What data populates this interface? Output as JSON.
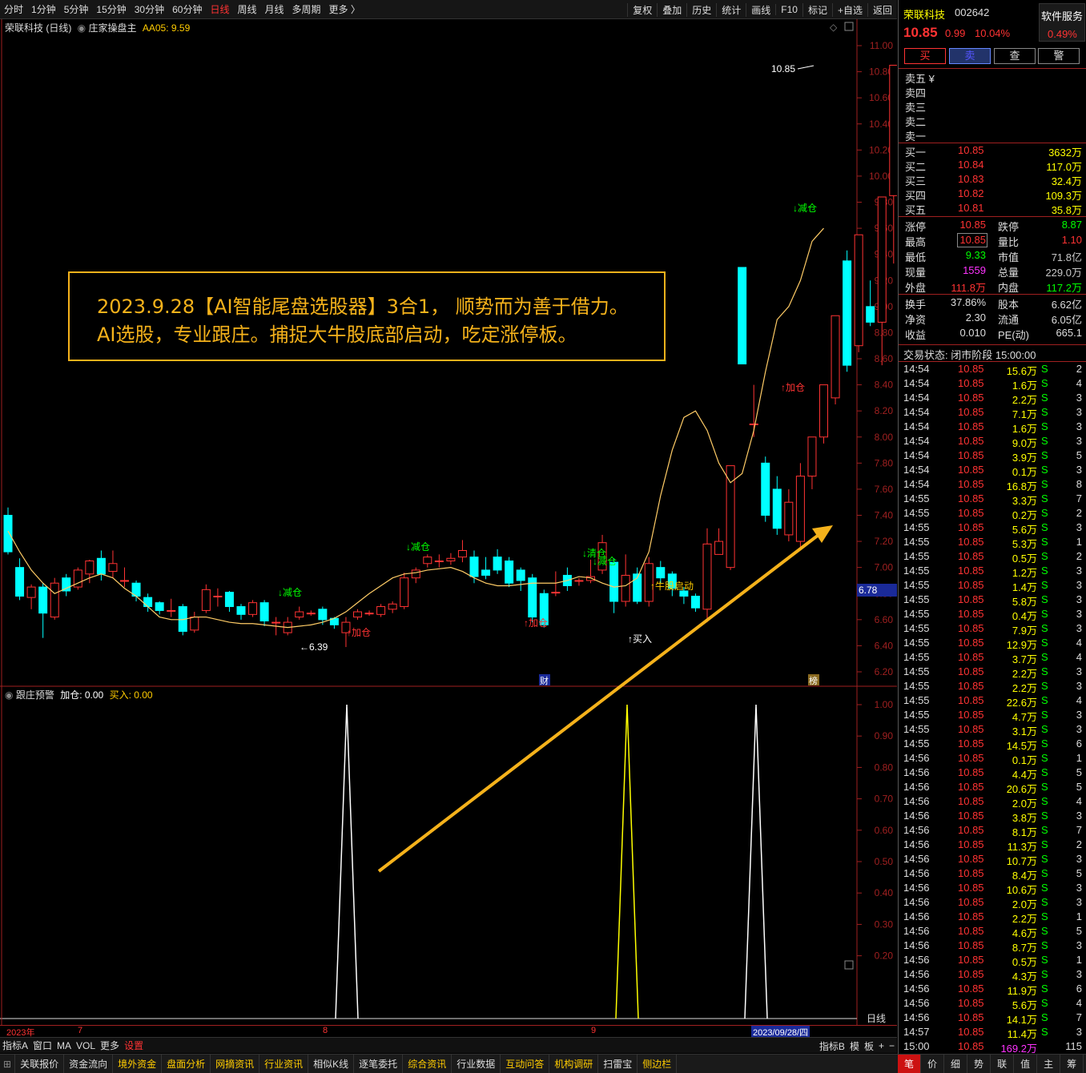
{
  "toolbar": {
    "periods": [
      "分时",
      "1分钟",
      "5分钟",
      "15分钟",
      "30分钟",
      "60分钟",
      "日线",
      "周线",
      "月线",
      "多周期",
      "更多 〉"
    ],
    "active_period": "日线",
    "tools": [
      "复权",
      "叠加",
      "历史",
      "统计",
      "画线",
      "F10",
      "标记",
      "+自选",
      "返回"
    ]
  },
  "chart": {
    "title": "荣联科技 (日线)",
    "indicator_name": "庄家操盘主",
    "indicator_value": "AA05: 9.59",
    "price_ticks": [
      "11.00",
      "10.80",
      "10.60",
      "10.40",
      "10.20",
      "10.00",
      "9.80",
      "9.60",
      "9.40",
      "9.20",
      "9.00",
      "8.80",
      "8.60",
      "8.40",
      "8.20",
      "8.00",
      "7.80",
      "7.60",
      "7.40",
      "7.20",
      "7.00",
      "6.80",
      "6.60",
      "6.40",
      "6.20"
    ],
    "current_price_tag": "6.78",
    "high_label": "10.85",
    "low_label": "6.39",
    "ad_text_line1": "2023.9.28【AI智能尾盘选股器】3合1， 顺势而为善于借力。",
    "ad_text_line2": "AI选股，专业跟庄。捕捉大牛股底部启动，吃定涨停板。",
    "signals": [
      {
        "text": "↓减仓",
        "color": "#00ff00"
      },
      {
        "text": "↓减仓",
        "color": "#00ff00"
      },
      {
        "text": "↓清仓",
        "color": "#00ff00"
      },
      {
        "text": "↓减仓",
        "color": "#00ff00"
      },
      {
        "text": "↓减仓",
        "color": "#00ff00"
      },
      {
        "text": "↑加仓",
        "color": "#ff3333"
      },
      {
        "text": "↑加仓",
        "color": "#ff3333"
      },
      {
        "text": "↑加仓",
        "color": "#ff3333"
      },
      {
        "text": "↑买入",
        "color": "#ffffff"
      },
      {
        "text": "↑牛股启动",
        "color": "#ffcc00"
      }
    ],
    "markers": [
      "财",
      "榜"
    ],
    "sub_title": "跟庄预警",
    "sub_value1": "加仓: 0.00",
    "sub_value2": "买入: 0.00",
    "sub_ticks": [
      "1.00",
      "0.90",
      "0.80",
      "0.70",
      "0.60",
      "0.50",
      "0.40",
      "0.30",
      "0.20"
    ],
    "period_label": "日线"
  },
  "date_axis": [
    "2023年",
    "7",
    "8",
    "9",
    "2023/09/28/四"
  ],
  "bottom_tabs1": {
    "left": [
      "指标A",
      "窗口",
      "MA",
      "VOL",
      "更多",
      "设置"
    ],
    "right": [
      "指标B",
      "模",
      "板",
      "+",
      "−"
    ]
  },
  "bottom_tabs2": [
    "关联报价",
    "资金流向",
    "境外资金",
    "盘面分析",
    "网摘资讯",
    "行业资讯",
    "相似K线",
    "逐笔委托",
    "综合资讯",
    "行业数据",
    "互动问答",
    "机构调研",
    "扫雷宝",
    "侧边栏"
  ],
  "bottom_right_tabs": [
    "笔",
    "价",
    "细",
    "势",
    "联",
    "值",
    "主",
    "筹"
  ],
  "quote": {
    "name": "荣联科技",
    "code": "002642",
    "service": "软件服务",
    "service_pct": "0.49%",
    "price": "10.85",
    "change": "0.99",
    "change_pct": "10.04%",
    "buttons": [
      "买",
      "卖",
      "查",
      "警"
    ],
    "sell_levels": [
      "卖五 ¥",
      "卖四",
      "卖三",
      "卖二",
      "卖一"
    ],
    "buy_levels": [
      {
        "label": "买一",
        "price": "10.85",
        "vol": "3632万"
      },
      {
        "label": "买二",
        "price": "10.84",
        "vol": "117.0万"
      },
      {
        "label": "买三",
        "price": "10.83",
        "vol": "32.4万"
      },
      {
        "label": "买四",
        "price": "10.82",
        "vol": "109.3万"
      },
      {
        "label": "买五",
        "price": "10.81",
        "vol": "35.8万"
      }
    ],
    "stats": [
      {
        "l1": "涨停",
        "v1": "10.85",
        "c1": "#ff3333",
        "l2": "跌停",
        "v2": "8.87",
        "c2": "#00ff00"
      },
      {
        "l1": "最高",
        "v1": "10.85",
        "c1": "#ff3333",
        "l2": "量比",
        "v2": "1.10",
        "c2": "#ff3333"
      },
      {
        "l1": "最低",
        "v1": "9.33",
        "c1": "#00ff00",
        "l2": "市值",
        "v2": "71.8亿",
        "c2": "#c8c8c8"
      },
      {
        "l1": "现量",
        "v1": "1559",
        "c1": "#ff33ff",
        "l2": "总量",
        "v2": "229.0万",
        "c2": "#c8c8c8"
      },
      {
        "l1": "外盘",
        "v1": "111.8万",
        "c1": "#ff3333",
        "l2": "内盘",
        "v2": "117.2万",
        "c2": "#00ff00"
      }
    ],
    "stats2": [
      {
        "l1": "换手",
        "v1": "37.86%",
        "l2": "股本",
        "v2": "6.62亿"
      },
      {
        "l1": "净资",
        "v1": "2.30",
        "l2": "流通",
        "v2": "6.05亿"
      },
      {
        "l1": "收益",
        "v1": "0.010",
        "l2": "PE(动)",
        "v2": "665.1"
      }
    ],
    "status": "交易状态: 闭市阶段 15:00:00"
  },
  "trades": [
    [
      "14:54",
      "10.85",
      "15.6万",
      "S",
      "2"
    ],
    [
      "14:54",
      "10.85",
      "1.6万",
      "S",
      "4"
    ],
    [
      "14:54",
      "10.85",
      "2.2万",
      "S",
      "3"
    ],
    [
      "14:54",
      "10.85",
      "7.1万",
      "S",
      "3"
    ],
    [
      "14:54",
      "10.85",
      "1.6万",
      "S",
      "3"
    ],
    [
      "14:54",
      "10.85",
      "9.0万",
      "S",
      "3"
    ],
    [
      "14:54",
      "10.85",
      "3.9万",
      "S",
      "5"
    ],
    [
      "14:54",
      "10.85",
      "0.1万",
      "S",
      "3"
    ],
    [
      "14:54",
      "10.85",
      "16.8万",
      "S",
      "8"
    ],
    [
      "14:55",
      "10.85",
      "3.3万",
      "S",
      "7"
    ],
    [
      "14:55",
      "10.85",
      "0.2万",
      "S",
      "2"
    ],
    [
      "14:55",
      "10.85",
      "5.6万",
      "S",
      "3"
    ],
    [
      "14:55",
      "10.85",
      "5.3万",
      "S",
      "1"
    ],
    [
      "14:55",
      "10.85",
      "0.5万",
      "S",
      "2"
    ],
    [
      "14:55",
      "10.85",
      "1.2万",
      "S",
      "3"
    ],
    [
      "14:55",
      "10.85",
      "1.4万",
      "S",
      "3"
    ],
    [
      "14:55",
      "10.85",
      "5.8万",
      "S",
      "3"
    ],
    [
      "14:55",
      "10.85",
      "0.4万",
      "S",
      "3"
    ],
    [
      "14:55",
      "10.85",
      "7.9万",
      "S",
      "3"
    ],
    [
      "14:55",
      "10.85",
      "12.9万",
      "S",
      "4"
    ],
    [
      "14:55",
      "10.85",
      "3.7万",
      "S",
      "4"
    ],
    [
      "14:55",
      "10.85",
      "2.2万",
      "S",
      "3"
    ],
    [
      "14:55",
      "10.85",
      "2.2万",
      "S",
      "3"
    ],
    [
      "14:55",
      "10.85",
      "22.6万",
      "S",
      "4"
    ],
    [
      "14:55",
      "10.85",
      "4.7万",
      "S",
      "3"
    ],
    [
      "14:55",
      "10.85",
      "3.1万",
      "S",
      "3"
    ],
    [
      "14:55",
      "10.85",
      "14.5万",
      "S",
      "6"
    ],
    [
      "14:56",
      "10.85",
      "0.1万",
      "S",
      "1"
    ],
    [
      "14:56",
      "10.85",
      "4.4万",
      "S",
      "5"
    ],
    [
      "14:56",
      "10.85",
      "20.6万",
      "S",
      "5"
    ],
    [
      "14:56",
      "10.85",
      "2.0万",
      "S",
      "4"
    ],
    [
      "14:56",
      "10.85",
      "3.8万",
      "S",
      "3"
    ],
    [
      "14:56",
      "10.85",
      "8.1万",
      "S",
      "7"
    ],
    [
      "14:56",
      "10.85",
      "11.3万",
      "S",
      "2"
    ],
    [
      "14:56",
      "10.85",
      "10.7万",
      "S",
      "3"
    ],
    [
      "14:56",
      "10.85",
      "8.4万",
      "S",
      "5"
    ],
    [
      "14:56",
      "10.85",
      "10.6万",
      "S",
      "3"
    ],
    [
      "14:56",
      "10.85",
      "2.0万",
      "S",
      "3"
    ],
    [
      "14:56",
      "10.85",
      "2.2万",
      "S",
      "1"
    ],
    [
      "14:56",
      "10.85",
      "4.6万",
      "S",
      "5"
    ],
    [
      "14:56",
      "10.85",
      "8.7万",
      "S",
      "3"
    ],
    [
      "14:56",
      "10.85",
      "0.5万",
      "S",
      "1"
    ],
    [
      "14:56",
      "10.85",
      "4.3万",
      "S",
      "3"
    ],
    [
      "14:56",
      "10.85",
      "11.9万",
      "S",
      "6"
    ],
    [
      "14:56",
      "10.85",
      "5.6万",
      "S",
      "4"
    ],
    [
      "14:56",
      "10.85",
      "14.1万",
      "S",
      "7"
    ],
    [
      "14:57",
      "10.85",
      "11.4万",
      "S",
      "3"
    ],
    [
      "15:00",
      "10.85",
      "169.2万",
      "",
      "115"
    ]
  ],
  "chart_data": {
    "type": "candlestick",
    "ylim": [
      6.2,
      11.0
    ],
    "ma_values": [
      7.28,
      7.12,
      6.98,
      6.88,
      6.8,
      6.84,
      6.88,
      6.92,
      6.95,
      6.92,
      6.84,
      6.78,
      6.7,
      6.62,
      6.6,
      6.6,
      6.62,
      6.62,
      6.6,
      6.58,
      6.57,
      6.57,
      6.56,
      6.55,
      6.54,
      6.55,
      6.56,
      6.58,
      6.61,
      6.66,
      6.73,
      6.8,
      6.86,
      6.92,
      6.95,
      6.96,
      6.98,
      6.99,
      7.0,
      6.97,
      6.92,
      6.88,
      6.86,
      6.86,
      6.87,
      6.88,
      6.88,
      6.88,
      6.9,
      6.93,
      6.92,
      6.88,
      6.85,
      6.86,
      6.92,
      7.12,
      7.55,
      7.9,
      8.15,
      8.2,
      8.05,
      7.8,
      7.65,
      7.72,
      8.05,
      8.5,
      8.9,
      9.0,
      9.2,
      9.5,
      9.6
    ],
    "candles": [
      [
        7.4,
        7.12,
        7.46,
        7.1
      ],
      [
        7.0,
        6.78,
        7.07,
        6.75
      ],
      [
        6.77,
        6.85,
        6.87,
        6.68
      ],
      [
        6.85,
        6.65,
        6.88,
        6.46
      ],
      [
        6.62,
        6.88,
        6.92,
        6.6
      ],
      [
        6.92,
        6.82,
        6.95,
        6.78
      ],
      [
        6.85,
        6.98,
        7.0,
        6.83
      ],
      [
        6.95,
        7.05,
        7.06,
        6.88
      ],
      [
        7.07,
        6.95,
        7.13,
        6.9
      ],
      [
        6.97,
        7.03,
        7.13,
        6.92
      ],
      [
        6.9,
        6.9,
        7.0,
        6.85
      ],
      [
        6.88,
        6.78,
        6.9,
        6.74
      ],
      [
        6.77,
        6.7,
        6.8,
        6.66
      ],
      [
        6.73,
        6.67,
        6.74,
        6.64
      ],
      [
        6.67,
        6.67,
        6.76,
        6.62
      ],
      [
        6.7,
        6.51,
        6.72,
        6.48
      ],
      [
        6.52,
        6.62,
        6.66,
        6.5
      ],
      [
        6.67,
        6.83,
        6.87,
        6.65
      ],
      [
        6.78,
        6.78,
        6.84,
        6.7
      ],
      [
        6.81,
        6.7,
        6.82,
        6.66
      ],
      [
        6.7,
        6.64,
        6.72,
        6.6
      ],
      [
        6.64,
        6.73,
        6.75,
        6.62
      ],
      [
        6.73,
        6.59,
        6.75,
        6.55
      ],
      [
        6.58,
        6.58,
        6.62,
        6.48
      ],
      [
        6.5,
        6.58,
        6.62,
        6.48
      ],
      [
        6.62,
        6.66,
        6.7,
        6.6
      ],
      [
        6.65,
        6.65,
        6.67,
        6.63
      ],
      [
        6.68,
        6.6,
        6.7,
        6.56
      ],
      [
        6.61,
        6.56,
        6.62,
        6.53
      ],
      [
        6.5,
        6.58,
        6.62,
        6.39
      ],
      [
        6.62,
        6.66,
        6.68,
        6.6
      ],
      [
        6.65,
        6.65,
        6.67,
        6.63
      ],
      [
        6.64,
        6.7,
        6.72,
        6.62
      ],
      [
        6.68,
        6.72,
        6.74,
        6.65
      ],
      [
        6.7,
        6.92,
        6.96,
        6.68
      ],
      [
        6.92,
        6.98,
        7.0,
        6.88
      ],
      [
        7.03,
        7.08,
        7.1,
        7.0
      ],
      [
        7.05,
        7.05,
        7.1,
        7.0
      ],
      [
        7.05,
        7.07,
        7.11,
        7.02
      ],
      [
        7.08,
        7.13,
        7.21,
        7.04
      ],
      [
        7.08,
        6.93,
        7.13,
        6.88
      ],
      [
        6.98,
        6.94,
        7.08,
        6.91
      ],
      [
        7.08,
        6.98,
        7.14,
        6.95
      ],
      [
        7.05,
        6.88,
        7.08,
        6.85
      ],
      [
        6.98,
        6.9,
        7.0,
        6.82
      ],
      [
        6.92,
        6.62,
        6.95,
        6.58
      ],
      [
        6.8,
        6.56,
        6.83,
        6.54
      ],
      [
        6.81,
        6.81,
        6.97,
        6.78
      ],
      [
        6.94,
        6.86,
        7.0,
        6.82
      ],
      [
        6.9,
        6.9,
        6.92,
        6.86
      ],
      [
        6.9,
        6.93,
        7.06,
        6.88
      ],
      [
        6.98,
        7.19,
        7.25,
        6.95
      ],
      [
        7.04,
        6.74,
        7.07,
        6.65
      ],
      [
        6.74,
        6.94,
        7.1,
        6.7
      ],
      [
        6.95,
        6.74,
        7.0,
        6.72
      ],
      [
        6.74,
        7.03,
        7.08,
        6.7
      ],
      [
        7.0,
        6.92,
        7.05,
        6.88
      ],
      [
        6.95,
        6.84,
        6.97,
        6.78
      ],
      [
        6.82,
        6.78,
        6.85,
        6.72
      ],
      [
        6.78,
        6.69,
        6.8,
        6.66
      ],
      [
        6.68,
        7.18,
        7.3,
        6.58
      ],
      [
        7.1,
        7.2,
        7.3,
        7.1
      ],
      [
        7.0,
        7.78,
        7.78,
        6.98
      ],
      [
        9.3,
        8.56,
        9.3,
        8.56
      ],
      [
        8.1,
        8.1,
        8.4,
        8.0
      ],
      [
        7.8,
        7.4,
        7.85,
        7.35
      ],
      [
        7.6,
        7.3,
        7.7,
        7.25
      ],
      [
        7.25,
        7.5,
        7.6,
        7.2
      ],
      [
        7.2,
        7.7,
        7.8,
        7.15
      ],
      [
        7.7,
        8.0,
        8.0,
        7.6
      ],
      [
        8.0,
        8.4,
        8.4,
        7.95
      ],
      [
        8.3,
        8.93,
        8.93,
        8.25
      ],
      [
        9.35,
        8.55,
        9.43,
        8.5
      ],
      [
        8.7,
        9.55,
        9.55,
        8.65
      ],
      [
        9.0,
        8.88,
        9.2,
        8.85
      ],
      [
        8.88,
        9.84,
        9.84,
        8.55
      ],
      [
        9.85,
        10.85,
        10.85,
        9.33
      ]
    ],
    "sub_peaks": [
      {
        "x": 433,
        "color": "#ffffff"
      },
      {
        "x": 783,
        "color": "#ffff00"
      },
      {
        "x": 944,
        "color": "#ffffff"
      }
    ]
  }
}
